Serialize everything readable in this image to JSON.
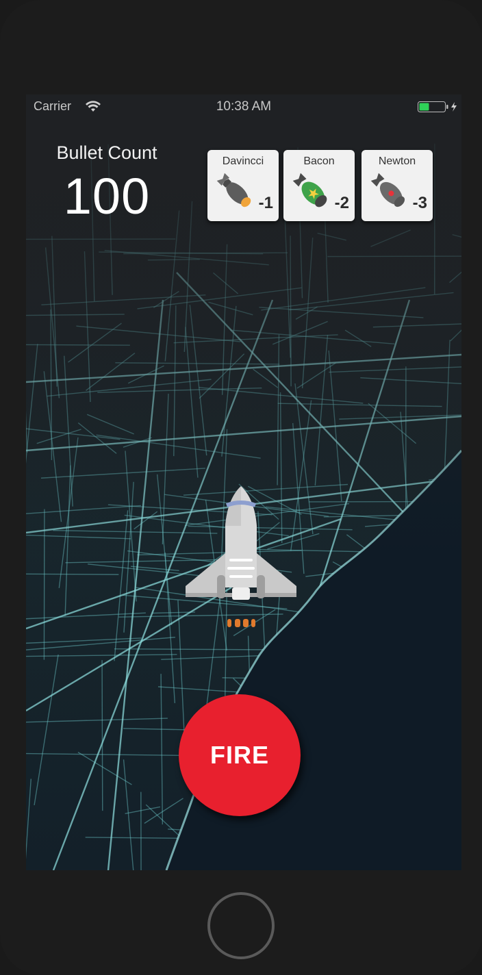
{
  "status_bar": {
    "carrier": "Carrier",
    "time": "10:38 AM",
    "wifi_icon": "wifi-icon",
    "battery_icon": "battery-charging-icon",
    "battery_color": "#2fd158"
  },
  "hud": {
    "bullet_label": "Bullet Count",
    "bullet_count": "100"
  },
  "weapons": [
    {
      "name": "Davincci",
      "cost": "-1",
      "icon": "bomb-icon",
      "color": "#5c5c5c"
    },
    {
      "name": "Bacon",
      "cost": "-2",
      "icon": "bomb-star-icon",
      "color": "#3fa34a"
    },
    {
      "name": "Newton",
      "cost": "-3",
      "icon": "bomb-red-dot-icon",
      "color": "#6a6a6a"
    }
  ],
  "player": {
    "icon": "space-shuttle-icon"
  },
  "controls": {
    "fire_label": "FIRE",
    "fire_color": "#e8202e"
  },
  "background": {
    "type": "city-map",
    "road_color": "#7fd6d6"
  }
}
